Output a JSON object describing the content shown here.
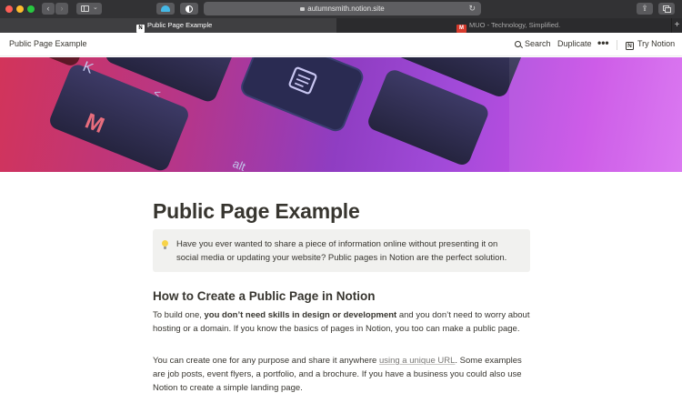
{
  "browser": {
    "url": "autumnsmith.notion.site",
    "tabs": [
      {
        "title": "Public Page Example",
        "active": true
      },
      {
        "title": "MUO - Technology, Simplified.",
        "active": false
      }
    ],
    "new_tab_icon": "plus-icon"
  },
  "topbar": {
    "breadcrumb": "Public Page Example",
    "search_label": "Search",
    "duplicate_label": "Duplicate",
    "more_label": "•••",
    "try_label": "Try Notion"
  },
  "page": {
    "title": "Public Page Example",
    "callout": {
      "icon": "lightbulb-icon",
      "text": "Have you ever wanted to share a piece of information online without presenting it on social media or updating your website? Public pages in Notion are the perfect solution."
    },
    "heading": "How to Create a Public Page in Notion",
    "para1": {
      "before": "To build one, ",
      "bold": "you don’t need skills in design or development",
      "after": " and you don’t need to worry about hosting or a domain. If you know the basics of pages in Notion, you too can make a public page."
    },
    "para2": {
      "before": "You can create one for any purpose and share it anywhere ",
      "link": "using a unique URL",
      "after": ". Some examples are job posts, event flyers, a portfolio, and a brochure. If you have a business you could also use Notion to create a simple landing page."
    }
  },
  "colors": {
    "text": "#37352f",
    "callout_bg": "#f1f1ef",
    "chrome_bg": "#3a3a3c"
  }
}
